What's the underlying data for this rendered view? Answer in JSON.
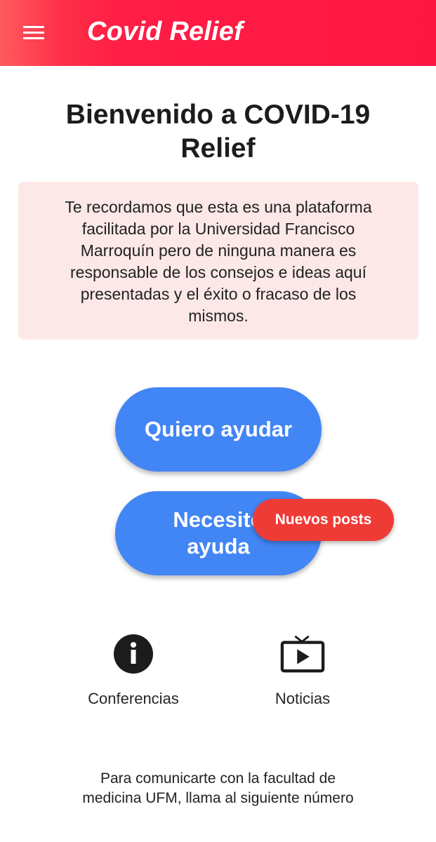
{
  "app_bar": {
    "title": "Covid Relief",
    "menu_icon": "menu-icon",
    "color": "#ff1744"
  },
  "main": {
    "welcome_title": "Bienvenido a COVID-19 Relief",
    "disclaimer": "Te recordamos que esta es una plataforma facilitada por la Universidad Francisco Marroquín pero de ninguna manera es responsable de los consejos e ideas aquí presentadas y el éxito o fracaso de los mismos.",
    "buttons": {
      "help_label": "Quiero ayudar",
      "need_help_label": "Necesito ayuda"
    },
    "new_posts_label": "Nuevos posts",
    "shortcuts": [
      {
        "label": "Conferencias",
        "icon": "info-icon"
      },
      {
        "label": "Noticias",
        "icon": "live-tv-icon"
      }
    ],
    "footer": "Para comunicarte con la facultad de medicina UFM, llama al siguiente número"
  },
  "colors": {
    "primary_button": "#4285f4",
    "badge": "#ef3b36",
    "disclaimer_bg": "#fde8e8"
  }
}
